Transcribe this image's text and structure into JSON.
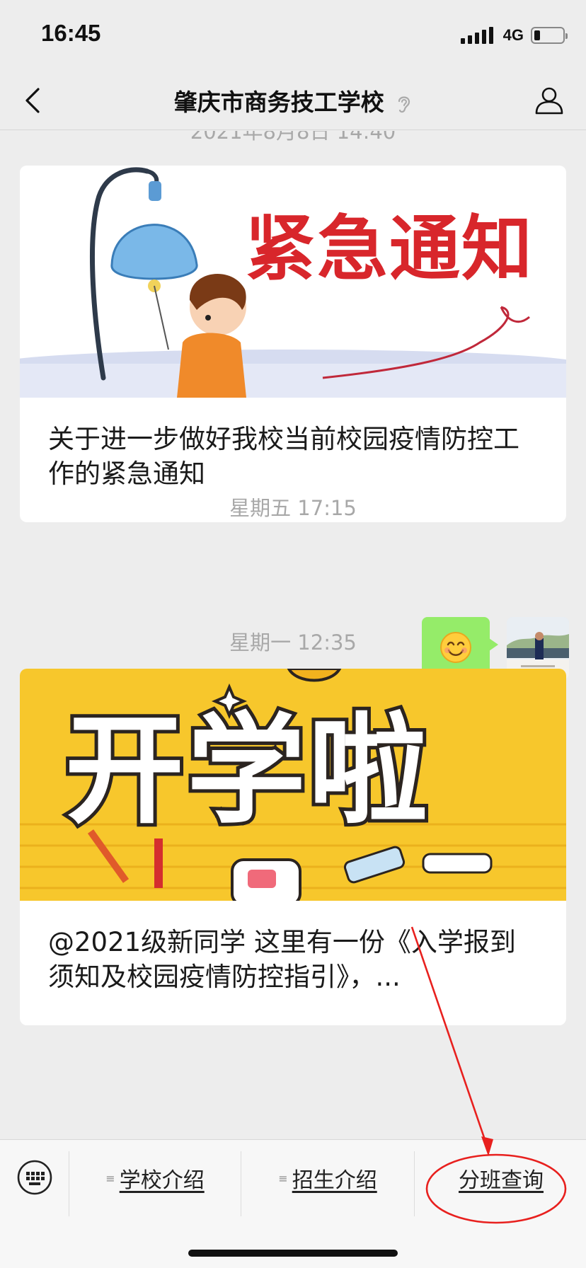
{
  "status_bar": {
    "time": "16:45",
    "network": "4G",
    "battery_level": 0.2
  },
  "nav": {
    "title": "肇庆市商务技工学校",
    "icons": [
      "back-arrow-icon",
      "ear-icon",
      "person-icon"
    ]
  },
  "chat": {
    "items": [
      {
        "type": "timestamp",
        "text": "2021年8月8日 14:40"
      },
      {
        "type": "article",
        "cover_text": "紧急通知",
        "title": "关于进一步做好我校当前校园疫情防控工作的紧急通知"
      },
      {
        "type": "timestamp",
        "text": "星期五 17:15"
      },
      {
        "type": "sent_message",
        "content_icon": "smiling-face-emoji",
        "avatar": "user-avatar"
      },
      {
        "type": "timestamp",
        "text": "星期一 12:35"
      },
      {
        "type": "article",
        "cover_text": "开学啦",
        "title": "@2021级新同学 这里有一份《入学报到须知及校园疫情防控指引》，..."
      }
    ]
  },
  "menu": {
    "keyboard_icon": "keyboard-icon",
    "items": [
      {
        "label": "学校介绍",
        "has_submenu": true
      },
      {
        "label": "招生介绍",
        "has_submenu": true
      },
      {
        "label": "分班查询",
        "has_submenu": false
      }
    ]
  },
  "colors": {
    "background": "#ededed",
    "bubble": "#95ec69",
    "annotation": "#e8201e",
    "notice_red": "#d8262b",
    "cover_yellow": "#f7c72c"
  }
}
